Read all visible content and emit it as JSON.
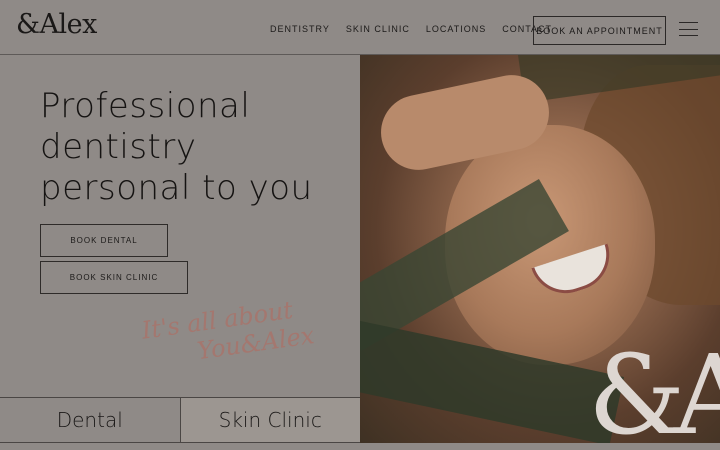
{
  "header": {
    "logo": "&Alex",
    "nav": [
      "DENTISTRY",
      "SKIN CLINIC",
      "LOCATIONS",
      "CONTACT"
    ],
    "cta": "BOOK AN APPOINTMENT"
  },
  "hero": {
    "headline": "Professional dentistry personal to you",
    "buttons": {
      "dental": "BOOK DENTAL",
      "skin": "BOOK SKIN CLINIC"
    },
    "script_line1": "It's all about",
    "script_line2": "You&Alex",
    "image_monogram": "&A"
  },
  "tabs": [
    "Dental",
    "Skin Clinic"
  ],
  "colors": {
    "background": "#8f8a87",
    "text": "#1c1a19",
    "script_accent": "#a4776f",
    "active_tab": "#9c9691"
  }
}
